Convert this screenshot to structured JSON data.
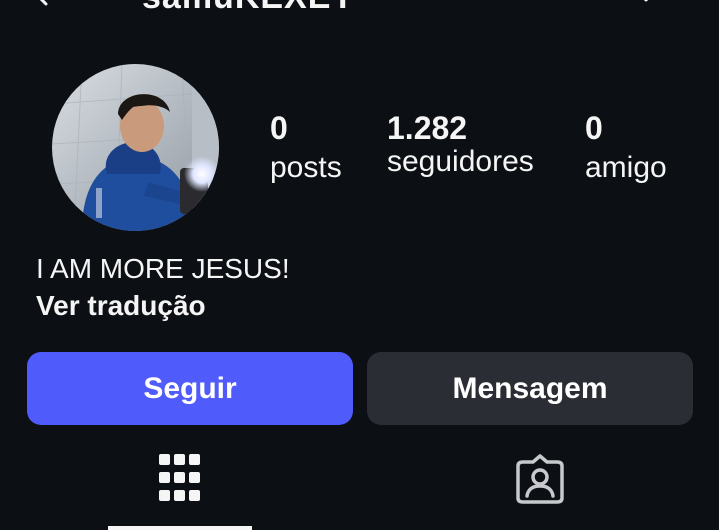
{
  "header": {
    "username": "samuKEXEY",
    "back_icon": "chevron-left-icon",
    "menu_icon": "chevron-down-icon"
  },
  "profile": {
    "avatar_icon": "avatar",
    "stats": [
      {
        "value": "0",
        "label": "posts"
      },
      {
        "value": "1.282",
        "label": "seguidores"
      },
      {
        "value": "0",
        "label": "amigo"
      }
    ],
    "bio": "I AM MORE JESUS!",
    "translate_label": "Ver tradução"
  },
  "actions": {
    "follow_label": "Seguir",
    "message_label": "Mensagem"
  },
  "tabs": [
    {
      "icon": "grid-icon",
      "active": true
    },
    {
      "icon": "tagged-person-icon",
      "active": false
    }
  ],
  "colors": {
    "background": "#0c1014",
    "follow_button": "#4f5bfa",
    "message_button": "#2a2d33",
    "text": "#f5f5f5"
  }
}
